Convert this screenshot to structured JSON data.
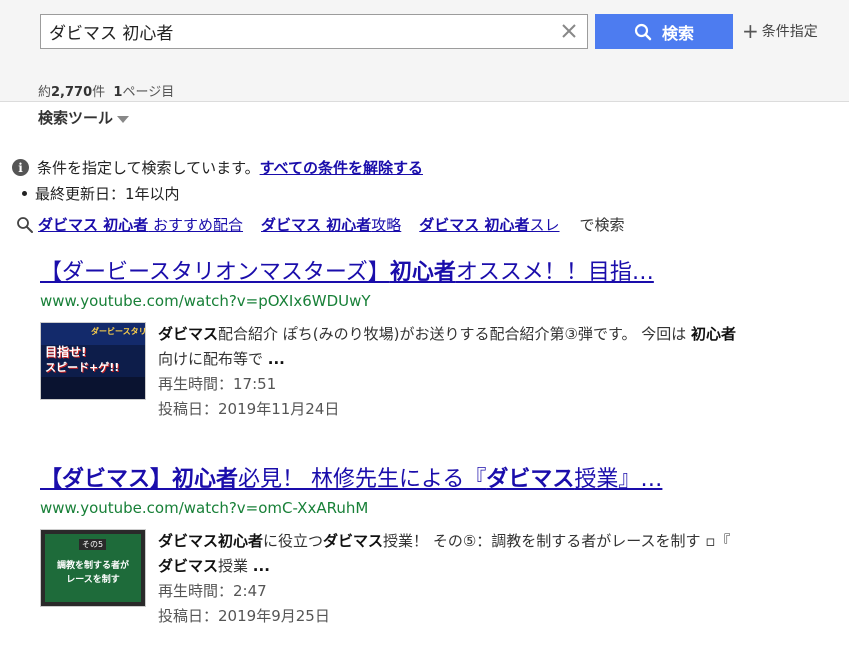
{
  "search": {
    "query": "ダビマス 初心者",
    "button_label": "検索",
    "conditions_label": "条件指定"
  },
  "summary": {
    "count_prefix": "約",
    "count": "2,770",
    "count_suffix": "件",
    "page_num": "1",
    "page_suffix": "ページ目"
  },
  "tools": {
    "label": "検索ツール"
  },
  "notice": {
    "text": "条件を指定して検索しています。",
    "link": "すべての条件を解除する"
  },
  "filter": {
    "text": "最終更新日：1年以内"
  },
  "related": {
    "items": [
      {
        "bold": "ダビマス 初心者",
        "rest": " おすすめ配合"
      },
      {
        "bold": "ダビマス 初心者",
        "rest": "攻略"
      },
      {
        "bold": "ダビマス 初心者",
        "rest": "スレ"
      }
    ],
    "suffix": "で検索"
  },
  "results": [
    {
      "title_parts": [
        {
          "t": "【ダービースタリオンマスターズ】",
          "b": false
        },
        {
          "t": "初心者",
          "b": true
        },
        {
          "t": "オススメ！！目指…",
          "b": false
        }
      ],
      "url": "www.youtube.com/watch?v=pOXIx6WDUwY",
      "snippet_parts": [
        {
          "t": "ダビマス",
          "b": true
        },
        {
          "t": "配合紹介 ぽち(みのり牧場)がお送りする配合紹介第③弾です。 今回は ",
          "b": false
        },
        {
          "t": "初心者",
          "b": true
        },
        {
          "t": " 向けに配布等で ",
          "b": false
        },
        {
          "t": "...",
          "b": true
        }
      ],
      "duration_label": "再生時間：",
      "duration": "17:51",
      "date_label": "投稿日：",
      "date": "2019年11月24日",
      "thumb": {
        "line1": "目指せ!",
        "line2": "スピード+ゲ!!",
        "badge": "ダービースタリオン"
      }
    },
    {
      "title_parts": [
        {
          "t": "【ダビマス】",
          "b": true
        },
        {
          "t": "初心者",
          "b": true
        },
        {
          "t": "必見！ 林修先生による『",
          "b": false
        },
        {
          "t": "ダビマス",
          "b": true
        },
        {
          "t": "授業』…",
          "b": false
        }
      ],
      "url": "www.youtube.com/watch?v=omC-XxARuhM",
      "snippet_parts": [
        {
          "t": "ダビマス初心者",
          "b": true
        },
        {
          "t": "に役立つ",
          "b": false
        },
        {
          "t": "ダビマス",
          "b": true
        },
        {
          "t": "授業！ その⑤：調教を制する者がレースを制す ▫『 ",
          "b": false
        },
        {
          "t": "ダビマス",
          "b": true
        },
        {
          "t": "授業 ",
          "b": false
        },
        {
          "t": "...",
          "b": true
        }
      ],
      "duration_label": "再生時間：",
      "duration": "2:47",
      "date_label": "投稿日：",
      "date": "2019年9月25日",
      "thumb": {
        "tag": "その5",
        "line1": "調教を制する者が",
        "line2": "レースを制す"
      }
    }
  ],
  "colors": {
    "link": "#1a0dab",
    "url": "#188038",
    "search_button": "#4d7cf0",
    "chalkboard": "#1e6b3a"
  },
  "icons": [
    "clear-icon",
    "search-icon",
    "plus-icon",
    "dropdown-icon",
    "info-icon",
    "magnifier-icon"
  ]
}
